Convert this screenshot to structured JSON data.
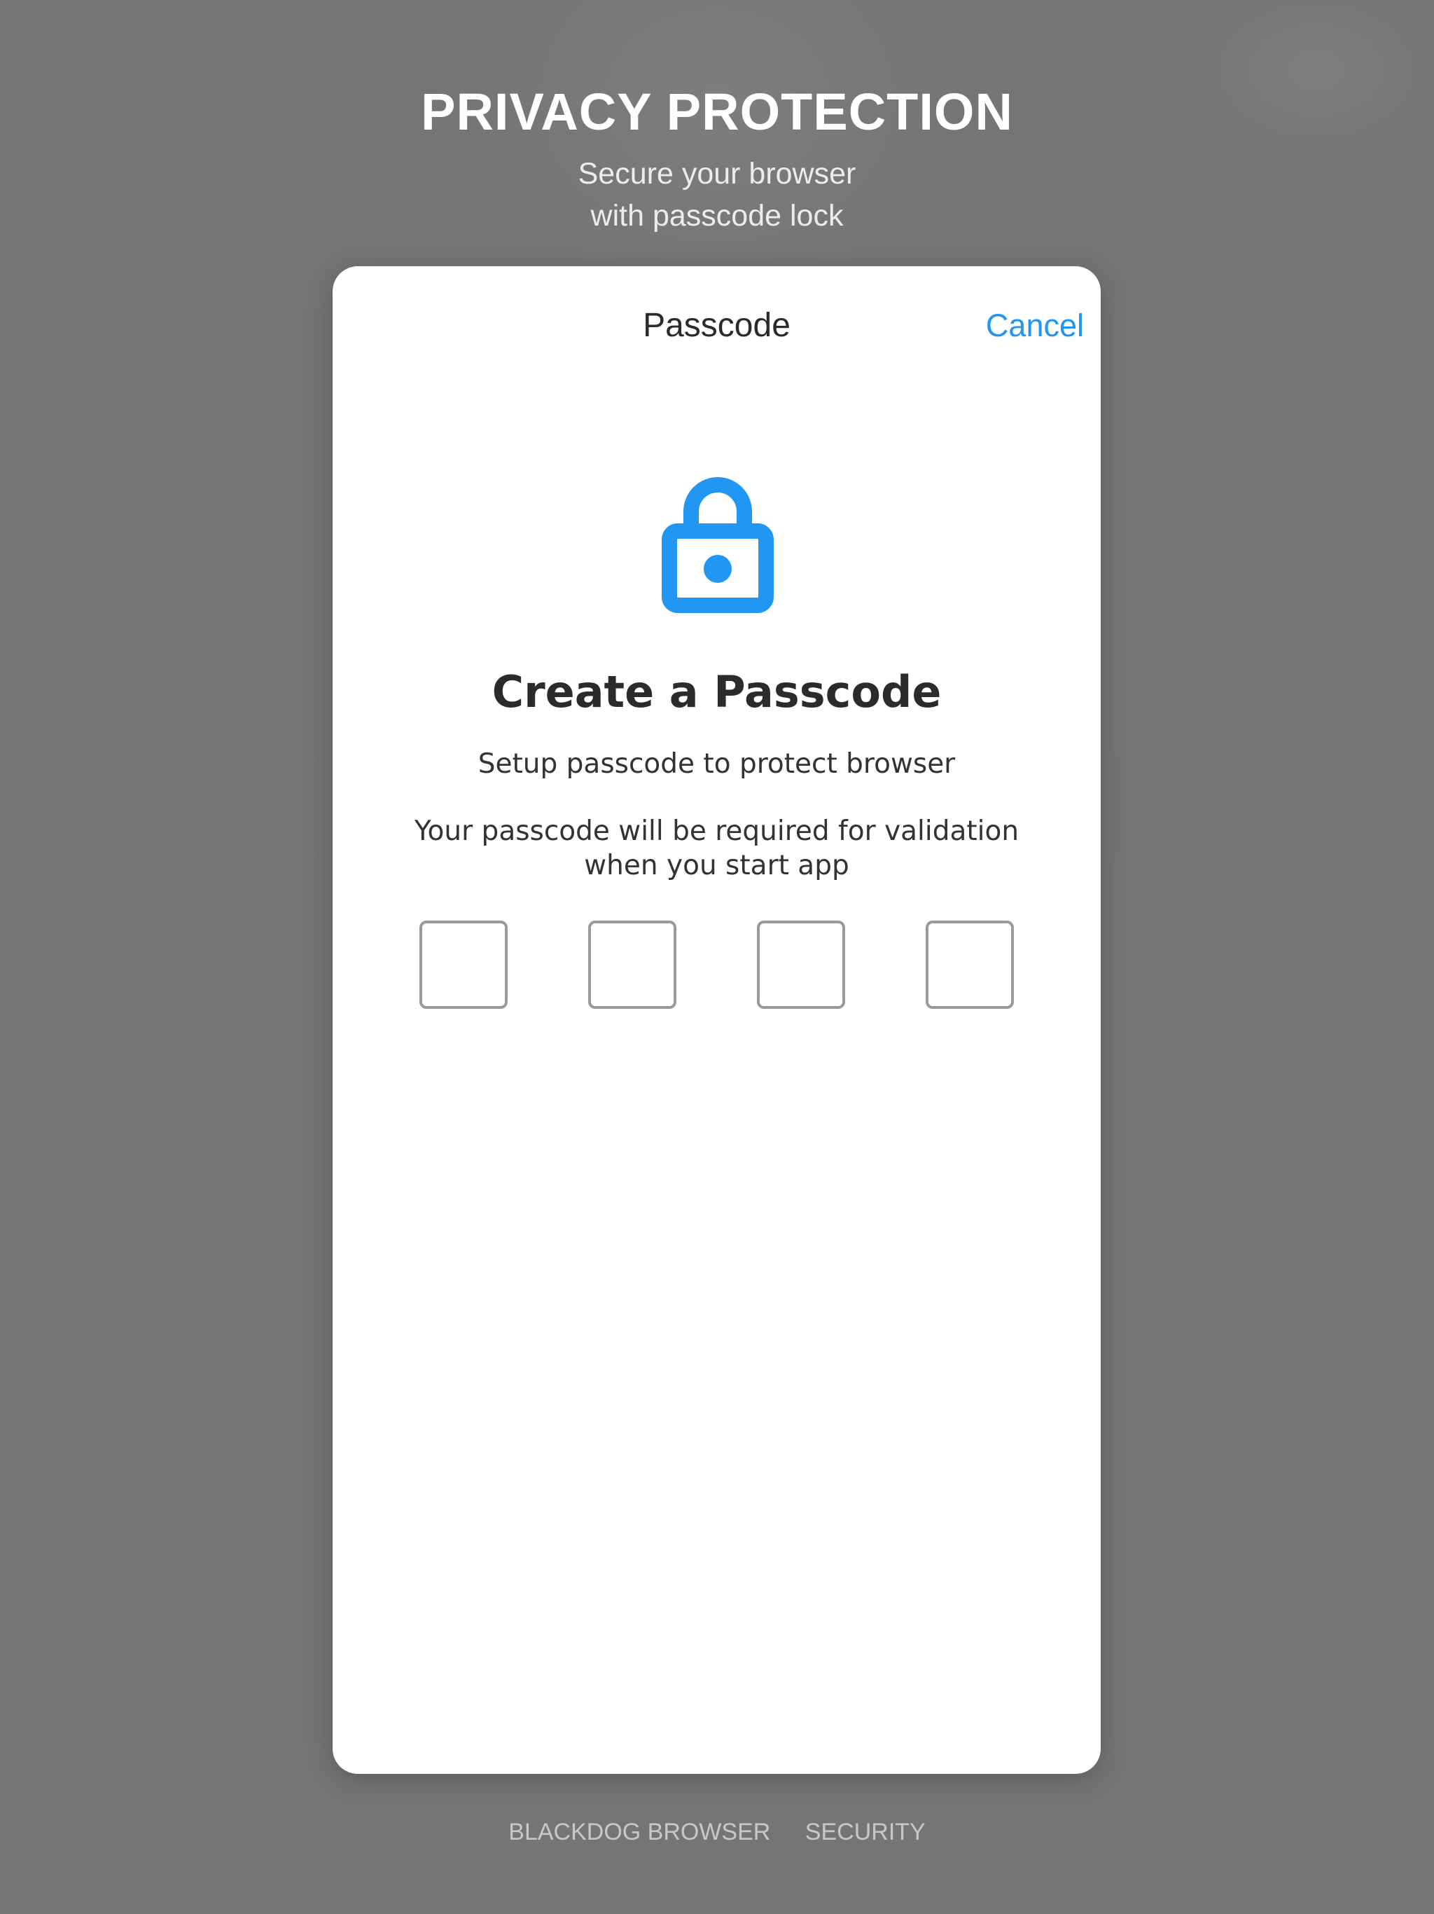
{
  "hero": {
    "title": "PRIVACY PROTECTION",
    "subtitle_line1": "Secure your browser",
    "subtitle_line2": "with passcode lock"
  },
  "modal": {
    "title": "Passcode",
    "cancel_label": "Cancel",
    "icon": "lock-icon",
    "heading": "Create a Passcode",
    "setup_text": "Setup passcode to protect browser",
    "info_line1": "Your passcode will be required for validation",
    "info_line2": "when you start app",
    "passcode_length": 4,
    "passcode_digits": [
      "",
      "",
      "",
      ""
    ]
  },
  "footer": {
    "brand": "BLACKDOG BROWSER",
    "section": "SECURITY"
  },
  "colors": {
    "accent": "#2196f3",
    "backdrop": "#757575",
    "text": "#2b2b2b",
    "box_border": "#9a9a9a"
  }
}
